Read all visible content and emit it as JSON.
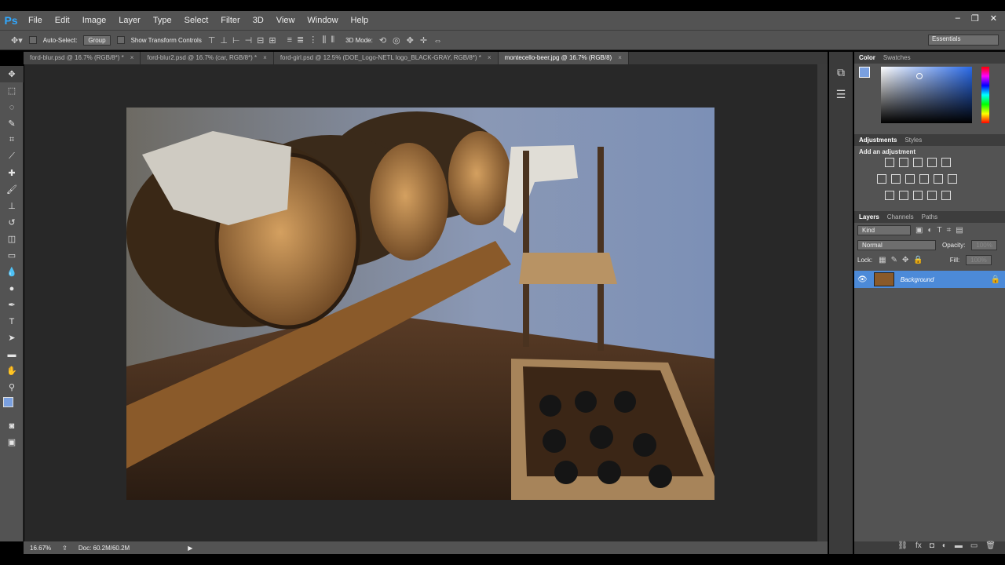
{
  "app": {
    "logo": "Ps"
  },
  "menu": [
    "File",
    "Edit",
    "Image",
    "Layer",
    "Type",
    "Select",
    "Filter",
    "3D",
    "View",
    "Window",
    "Help"
  ],
  "window_controls": {
    "minimize": "–",
    "restore": "❐",
    "close": "✕"
  },
  "options": {
    "auto_select": "Auto-Select:",
    "group": "Group",
    "show_transform": "Show Transform Controls",
    "mode_3d": "3D Mode:",
    "workspace": "Essentials"
  },
  "tabs": [
    {
      "label": "ford-blur.psd @ 16.7% (RGB/8*) *",
      "active": false
    },
    {
      "label": "ford-blur2.psd @ 16.7% (car, RGB/8*) *",
      "active": false
    },
    {
      "label": "ford-girl.psd @ 12.5% (DOE_Logo-NETL logo_BLACK-GRAY, RGB/8*) *",
      "active": false
    },
    {
      "label": "montecello-beer.jpg @ 16.7% (RGB/8)",
      "active": true
    }
  ],
  "tab_close": "×",
  "status": {
    "zoom": "16.67%",
    "doc": "Doc: 60.2M/60.2M"
  },
  "panels": {
    "color_tabs": [
      "Color",
      "Swatches"
    ],
    "adjust_tabs": [
      "Adjustments",
      "Styles"
    ],
    "adjust_title": "Add an adjustment",
    "layers_tabs": [
      "Layers",
      "Channels",
      "Paths"
    ],
    "kind": "Kind",
    "blend": "Normal",
    "opacity_label": "Opacity:",
    "opacity_value": "100%",
    "lock_label": "Lock:",
    "fill_label": "Fill:",
    "fill_value": "100%",
    "layer_name": "Background"
  },
  "colors": {
    "accent": "#4c8ad8",
    "panel": "#535353",
    "dark": "#282828",
    "fg_swatch": "#7aa0e0",
    "bg_swatch": "#ffffff"
  }
}
